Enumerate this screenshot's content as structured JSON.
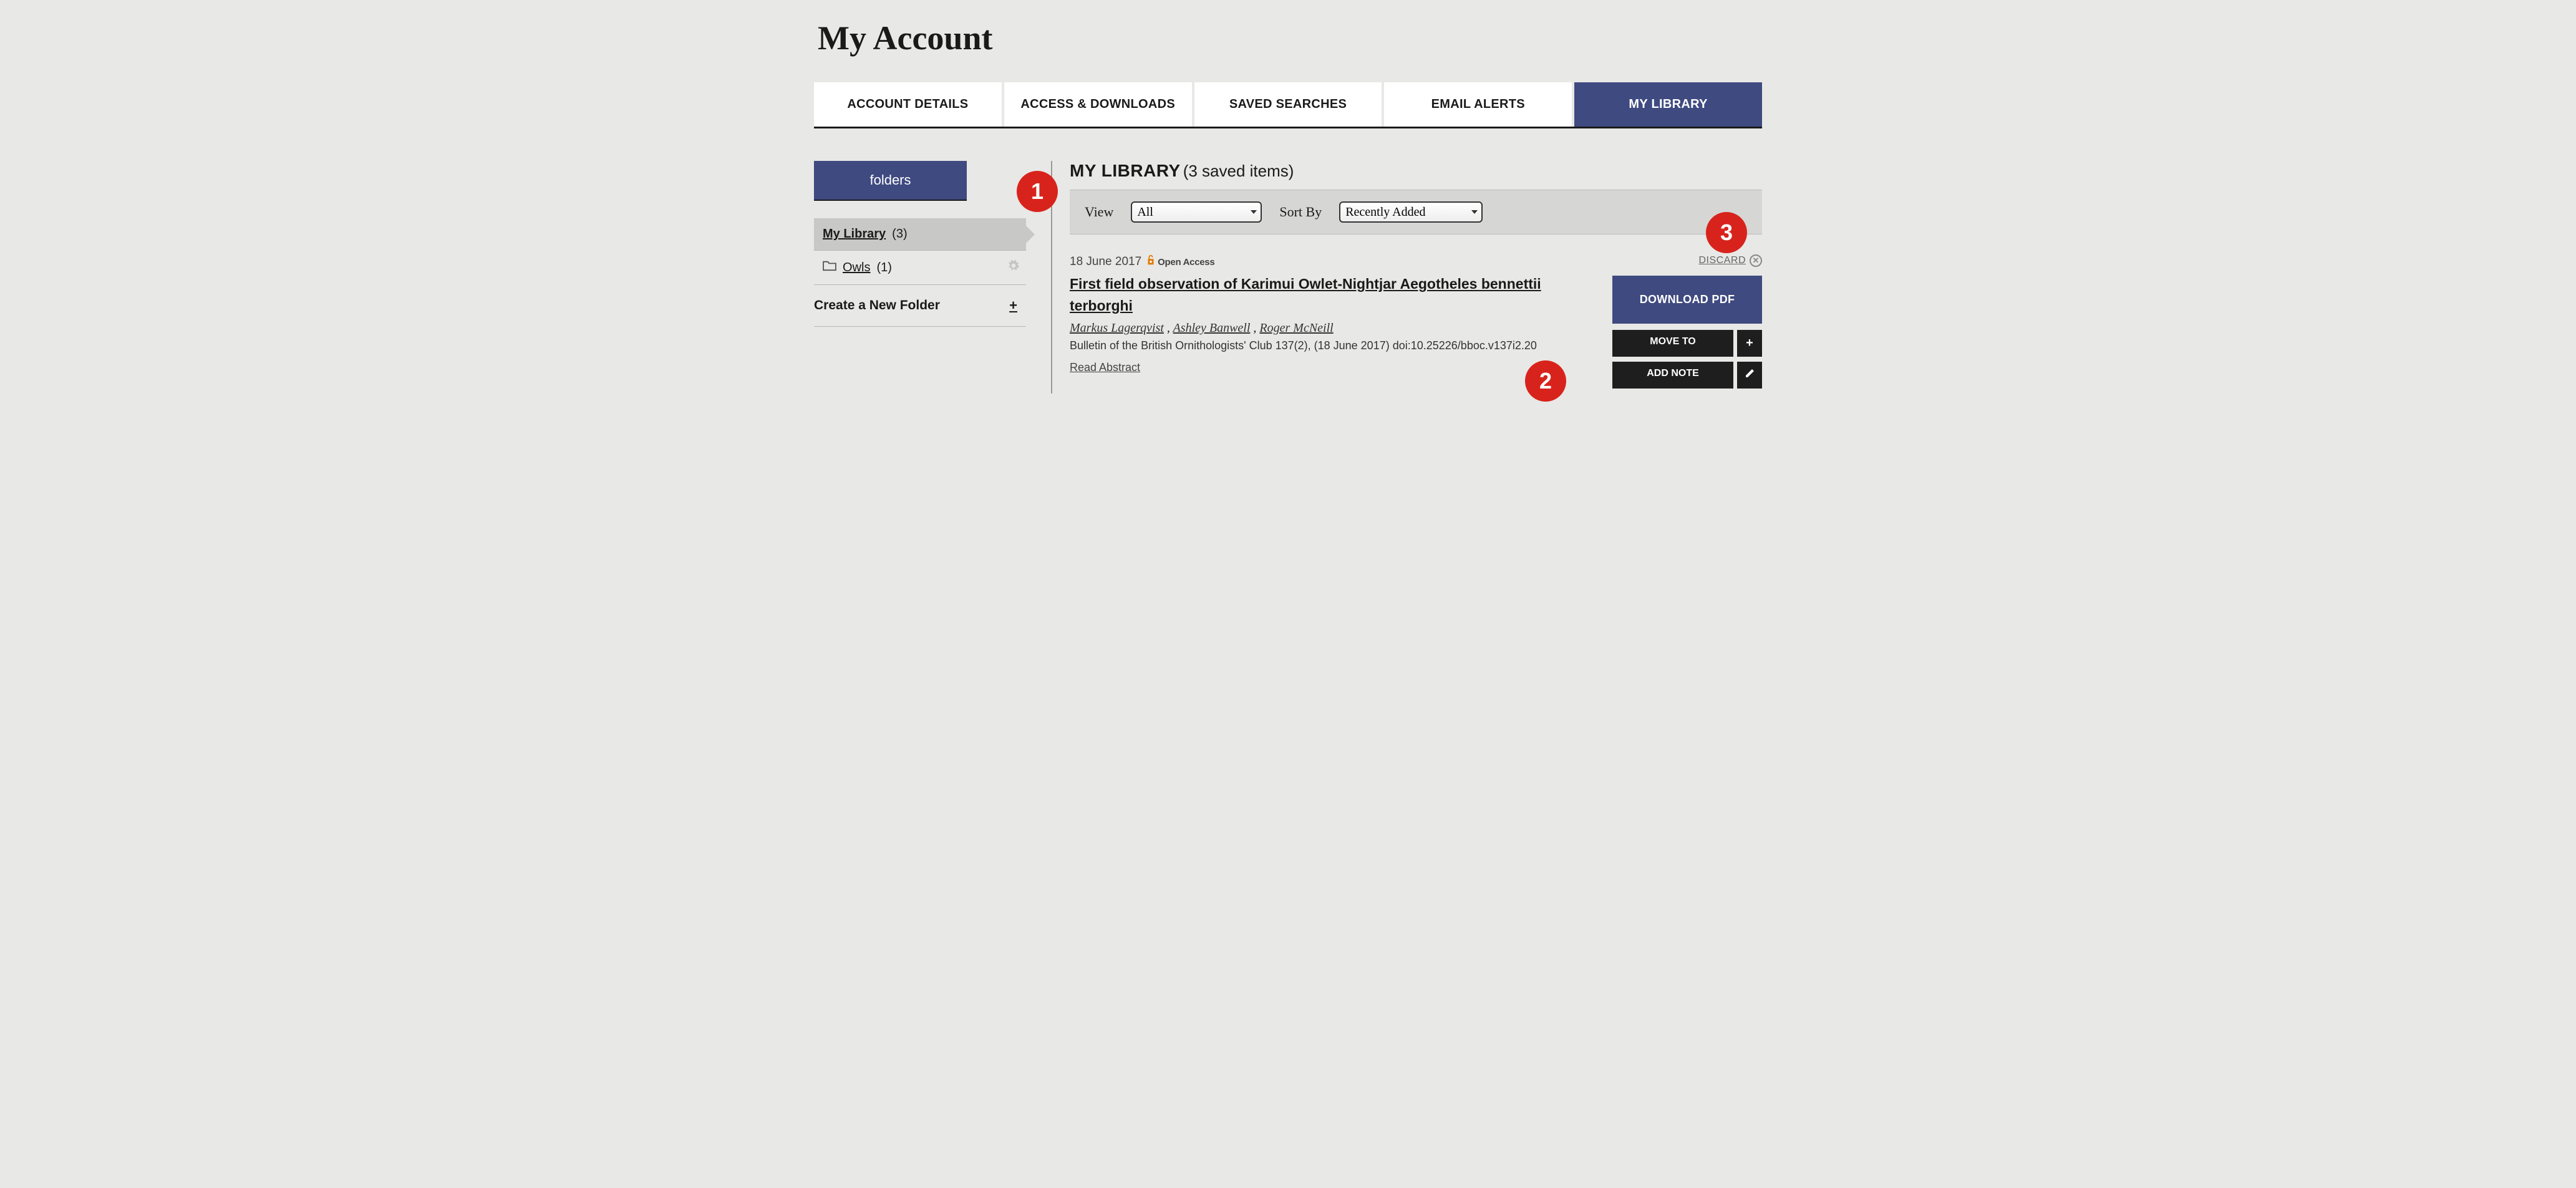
{
  "page_title": "My Account",
  "tabs": {
    "account_details": "ACCOUNT DETAILS",
    "access_downloads": "ACCESS & DOWNLOADS",
    "saved_searches": "SAVED SEARCHES",
    "email_alerts": "EMAIL ALERTS",
    "my_library": "MY LIBRARY"
  },
  "sidebar": {
    "tab_label": "folders",
    "my_library_label": "My Library",
    "my_library_count": "(3)",
    "owls_label": "Owls",
    "owls_count": "(1)",
    "create_folder_label": "Create a New Folder",
    "plus_glyph": "+"
  },
  "main": {
    "heading": "MY LIBRARY",
    "heading_count": "(3 saved items)",
    "view_label": "View",
    "view_value": "All",
    "sort_label": "Sort By",
    "sort_value": "Recently Added",
    "discard_label": "DISCARD"
  },
  "item": {
    "date": "18 June 2017",
    "oa_text": "Open Access",
    "title": "First field observation of Karimui Owlet-Nightjar Aegotheles bennettii terborghi",
    "author1": "Markus Lagerqvist",
    "author2": "Ashley Banwell",
    "author3": "Roger McNeill",
    "sep": " , ",
    "citation": "Bulletin of the British Ornithologists' Club 137(2), (18 June 2017) doi:10.25226/bboc.v137i2.20",
    "read_abstract": "Read Abstract"
  },
  "actions": {
    "download": "DOWNLOAD PDF",
    "move_to": "MOVE TO",
    "plus": "+",
    "add_note": "ADD NOTE"
  },
  "callouts": {
    "c1": "1",
    "c2": "2",
    "c3": "3"
  }
}
